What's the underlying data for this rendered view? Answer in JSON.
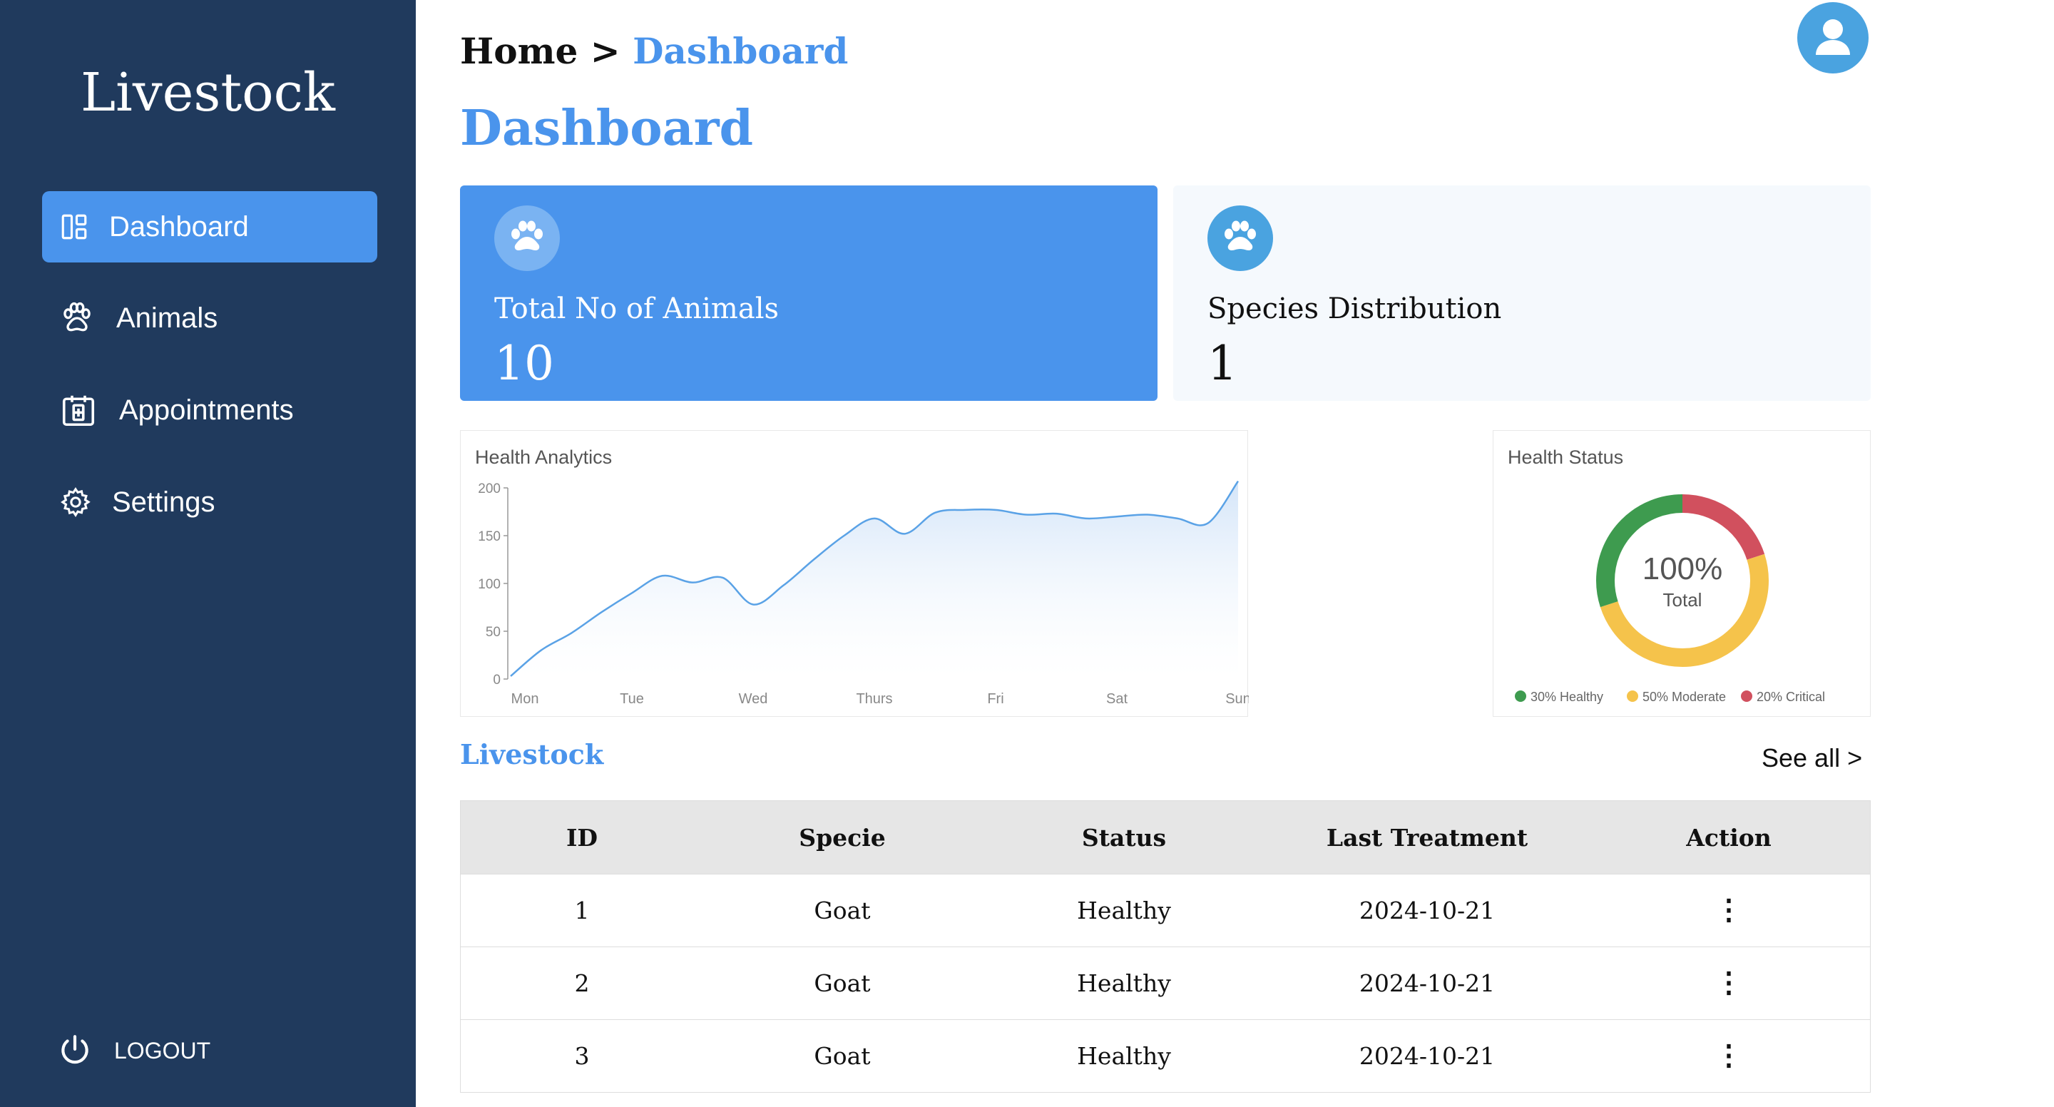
{
  "sidebar": {
    "brand": "Livestock",
    "items": [
      {
        "label": "Dashboard",
        "icon": "dashboard-icon",
        "active": true
      },
      {
        "label": "Animals",
        "icon": "paw-icon",
        "active": false
      },
      {
        "label": "Appointments",
        "icon": "medical-calendar-icon",
        "active": false
      },
      {
        "label": "Settings",
        "icon": "gear-icon",
        "active": false
      }
    ],
    "logout_label": "LOGOUT"
  },
  "header": {
    "breadcrumb_home": "Home",
    "breadcrumb_sep": ">",
    "breadcrumb_current": "Dashboard",
    "title": "Dashboard"
  },
  "cards": [
    {
      "label": "Total No of Animals",
      "value": "10",
      "icon": "paw-icon"
    },
    {
      "label": "Species Distribution",
      "value": "1",
      "icon": "paw-icon"
    }
  ],
  "chart_data": [
    {
      "type": "area",
      "title": "Health Analytics",
      "xlabel": "",
      "ylabel": "",
      "categories": [
        "Mon",
        "Tue",
        "Wed",
        "Thurs",
        "Fri",
        "Sat",
        "Sun"
      ],
      "x": [
        0,
        0.25,
        0.5,
        0.75,
        1,
        1.25,
        1.5,
        1.75,
        2,
        2.25,
        2.5,
        2.75,
        3,
        3.25,
        3.5,
        3.75,
        4,
        4.25,
        4.5,
        4.75,
        5,
        5.25,
        5.5,
        5.75,
        6
      ],
      "values": [
        3,
        30,
        48,
        70,
        90,
        108,
        101,
        106,
        78,
        98,
        125,
        150,
        168,
        152,
        174,
        177,
        177,
        172,
        173,
        168,
        170,
        172,
        168,
        163,
        207
      ],
      "ylim": [
        0,
        200
      ],
      "yticks": [
        0,
        50,
        100,
        150,
        200
      ],
      "grid": false,
      "line_color": "#5aa2e6"
    },
    {
      "type": "pie",
      "title": "Health Status",
      "center_value": "100%",
      "center_label": "Total",
      "categories": [
        "Healthy",
        "Moderate",
        "Critical"
      ],
      "values": [
        30,
        50,
        20
      ],
      "colors": [
        "#3e9b4f",
        "#f5c34b",
        "#d1505e"
      ],
      "legend": [
        "30% Healthy",
        "50% Moderate",
        "20% Critical"
      ],
      "legend_position": "bottom"
    }
  ],
  "livestock": {
    "title": "Livestock",
    "see_all": "See all >",
    "columns": [
      "ID",
      "Specie",
      "Status",
      "Last Treatment",
      "Action"
    ],
    "rows": [
      {
        "id": "1",
        "specie": "Goat",
        "status": "Healthy",
        "last_treatment": "2024-10-21",
        "action": "⋮"
      },
      {
        "id": "2",
        "specie": "Goat",
        "status": "Healthy",
        "last_treatment": "2024-10-21",
        "action": "⋮"
      },
      {
        "id": "3",
        "specie": "Goat",
        "status": "Healthy",
        "last_treatment": "2024-10-21",
        "action": "⋮"
      }
    ]
  },
  "colors": {
    "sidebar_bg": "#203a5d",
    "accent": "#4a94ec",
    "avatar": "#4aa3e0"
  }
}
